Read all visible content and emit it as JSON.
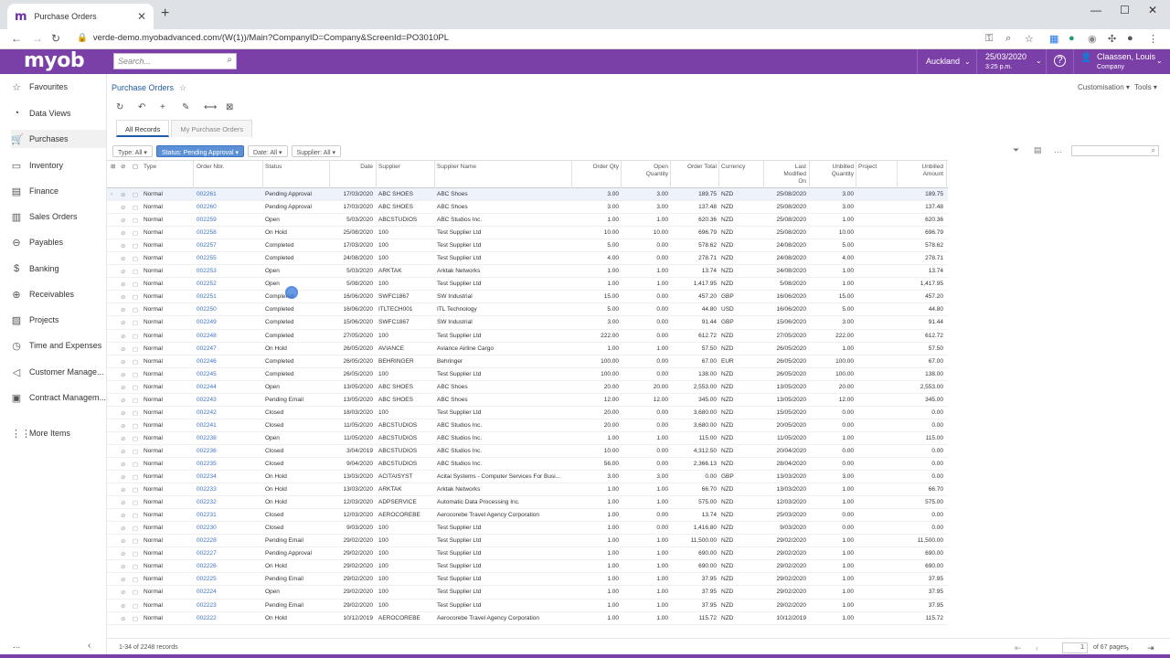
{
  "browser": {
    "tab_title": "Purchase Orders",
    "url": "verde-demo.myobadvanced.com/(W(1))/Main?CompanyID=Company&ScreenId=PO3010PL"
  },
  "topbar": {
    "logo": "myob",
    "search_placeholder": "Search...",
    "branch": "Auckland",
    "date": "25/03/2020",
    "time": "3:25 p.m.",
    "user_name": "Claassen, Louis",
    "user_company": "Company",
    "accent": "#7b3fa8"
  },
  "sidebar": {
    "items": [
      {
        "label": "Favourites",
        "icon": "star-icon"
      },
      {
        "label": "Data Views",
        "icon": "chart-icon"
      },
      {
        "label": "Purchases",
        "icon": "cart-icon"
      },
      {
        "label": "Inventory",
        "icon": "truck-icon"
      },
      {
        "label": "Finance",
        "icon": "document-icon"
      },
      {
        "label": "Sales Orders",
        "icon": "receipt-icon"
      },
      {
        "label": "Payables",
        "icon": "minus-circle-icon"
      },
      {
        "label": "Banking",
        "icon": "dollar-icon"
      },
      {
        "label": "Receivables",
        "icon": "plus-circle-icon"
      },
      {
        "label": "Projects",
        "icon": "projects-icon"
      },
      {
        "label": "Time and Expenses",
        "icon": "clock-icon"
      },
      {
        "label": "Customer Manage...",
        "icon": "megaphone-icon"
      },
      {
        "label": "Contract Managem...",
        "icon": "contract-icon"
      },
      {
        "label": "More Items",
        "icon": "grid-icon"
      }
    ],
    "footer_more": "...",
    "collapse": "‹"
  },
  "page": {
    "breadcrumb": "Purchase Orders",
    "customisation": "Customisation",
    "tools": "Tools",
    "tabs": [
      "All Records",
      "My Purchase Orders"
    ],
    "filters": [
      "Type: All",
      "Status: Pending Approval",
      "Date: All",
      "Supplier: All"
    ]
  },
  "grid": {
    "headers": {
      "type": "Type",
      "order_nbr": "Order Nbr.",
      "status": "Status",
      "date": "Date",
      "supplier": "Supplier",
      "supplier_name": "Supplier Name",
      "order_qty": "Order Qty",
      "open_qty_1": "Open",
      "open_qty_2": "Quantity",
      "order_total": "Order Total",
      "currency": "Currency",
      "last_mod_1": "Last",
      "last_mod_2": "Modified",
      "last_mod_3": "On",
      "unbilled_qty_1": "Unbilled",
      "unbilled_qty_2": "Quantity",
      "project": "Project",
      "unbilled_amt_1": "Unbilled",
      "unbilled_amt_2": "Amount"
    },
    "rows": [
      [
        "Normal",
        "002261",
        "Pending Approval",
        "17/03/2020",
        "ABC SHOES",
        "ABC Shoes",
        "3.00",
        "3.00",
        "189.75",
        "NZD",
        "25/08/2020",
        "3.00",
        "189.75"
      ],
      [
        "Normal",
        "002260",
        "Pending Approval",
        "17/03/2020",
        "ABC SHOES",
        "ABC Shoes",
        "3.00",
        "3.00",
        "137.48",
        "NZD",
        "25/08/2020",
        "3.00",
        "137.48"
      ],
      [
        "Normal",
        "002259",
        "Open",
        "5/03/2020",
        "ABCSTUDIOS",
        "ABC Studios Inc.",
        "1.00",
        "1.00",
        "620.36",
        "NZD",
        "25/08/2020",
        "1.00",
        "620.36"
      ],
      [
        "Normal",
        "002258",
        "On Hold",
        "25/08/2020",
        "100",
        "Test Supplier Ltd",
        "10.00",
        "10.00",
        "696.79",
        "NZD",
        "25/08/2020",
        "10.00",
        "696.79"
      ],
      [
        "Normal",
        "002257",
        "Completed",
        "17/03/2020",
        "100",
        "Test Supplier Ltd",
        "5.00",
        "0.00",
        "578.62",
        "NZD",
        "24/08/2020",
        "5.00",
        "578.62"
      ],
      [
        "Normal",
        "002255",
        "Completed",
        "24/08/2020",
        "100",
        "Test Supplier Ltd",
        "4.00",
        "0.00",
        "278.71",
        "NZD",
        "24/08/2020",
        "4.00",
        "278.71"
      ],
      [
        "Normal",
        "002253",
        "Open",
        "5/03/2020",
        "ARKTAK",
        "Arktak Networks",
        "1.00",
        "1.00",
        "13.74",
        "NZD",
        "24/08/2020",
        "1.00",
        "13.74"
      ],
      [
        "Normal",
        "002252",
        "Open",
        "5/08/2020",
        "100",
        "Test Supplier Ltd",
        "1.00",
        "1.00",
        "1,417.95",
        "NZD",
        "5/08/2020",
        "1.00",
        "1,417.95"
      ],
      [
        "Normal",
        "002251",
        "Completed",
        "16/06/2020",
        "SWFC1867",
        "SW Industrial",
        "15.00",
        "0.00",
        "457.20",
        "GBP",
        "16/06/2020",
        "15.00",
        "457.20"
      ],
      [
        "Normal",
        "002250",
        "Completed",
        "16/06/2020",
        "ITLTECH001",
        "ITL Technology",
        "5.00",
        "0.00",
        "44.80",
        "USD",
        "16/06/2020",
        "5.00",
        "44.80"
      ],
      [
        "Normal",
        "002249",
        "Completed",
        "15/06/2020",
        "SWFC1867",
        "SW Industrial",
        "3.00",
        "0.00",
        "91.44",
        "GBP",
        "15/06/2020",
        "3.00",
        "91.44"
      ],
      [
        "Normal",
        "002248",
        "Completed",
        "27/05/2020",
        "100",
        "Test Supplier Ltd",
        "222.00",
        "0.00",
        "612.72",
        "NZD",
        "27/05/2020",
        "222.00",
        "612.72"
      ],
      [
        "Normal",
        "002247",
        "On Hold",
        "26/05/2020",
        "AVIANCE",
        "Aviance Airline Cargo",
        "1.00",
        "1.00",
        "57.50",
        "NZD",
        "26/05/2020",
        "1.00",
        "57.50"
      ],
      [
        "Normal",
        "002246",
        "Completed",
        "26/05/2020",
        "BEHRINGER",
        "Behringer",
        "100.00",
        "0.00",
        "67.00",
        "EUR",
        "26/05/2020",
        "100.00",
        "67.00"
      ],
      [
        "Normal",
        "002245",
        "Completed",
        "26/05/2020",
        "100",
        "Test Supplier Ltd",
        "100.00",
        "0.00",
        "138.00",
        "NZD",
        "26/05/2020",
        "100.00",
        "138.00"
      ],
      [
        "Normal",
        "002244",
        "Open",
        "13/05/2020",
        "ABC SHOES",
        "ABC Shoes",
        "20.00",
        "20.00",
        "2,553.00",
        "NZD",
        "13/05/2020",
        "20.00",
        "2,553.00"
      ],
      [
        "Normal",
        "002243",
        "Pending Email",
        "13/05/2020",
        "ABC SHOES",
        "ABC Shoes",
        "12.00",
        "12.00",
        "345.00",
        "NZD",
        "13/05/2020",
        "12.00",
        "345.00"
      ],
      [
        "Normal",
        "002242",
        "Closed",
        "18/03/2020",
        "100",
        "Test Supplier Ltd",
        "20.00",
        "0.00",
        "3,680.00",
        "NZD",
        "15/05/2020",
        "0.00",
        "0.00"
      ],
      [
        "Normal",
        "002241",
        "Closed",
        "11/05/2020",
        "ABCSTUDIOS",
        "ABC Studios Inc.",
        "20.00",
        "0.00",
        "3,680.00",
        "NZD",
        "20/05/2020",
        "0.00",
        "0.00"
      ],
      [
        "Normal",
        "002238",
        "Open",
        "11/05/2020",
        "ABCSTUDIOS",
        "ABC Studios Inc.",
        "1.00",
        "1.00",
        "115.00",
        "NZD",
        "11/05/2020",
        "1.00",
        "115.00"
      ],
      [
        "Normal",
        "002236",
        "Closed",
        "3/04/2019",
        "ABCSTUDIOS",
        "ABC Studios Inc.",
        "10.00",
        "0.00",
        "4,312.50",
        "NZD",
        "20/04/2020",
        "0.00",
        "0.00"
      ],
      [
        "Normal",
        "002235",
        "Closed",
        "9/04/2020",
        "ABCSTUDIOS",
        "ABC Studios Inc.",
        "56.00",
        "0.00",
        "2,366.13",
        "NZD",
        "28/04/2020",
        "0.00",
        "0.00"
      ],
      [
        "Normal",
        "002234",
        "On Hold",
        "13/03/2020",
        "ACITAISYST",
        "Acitai Systems - Computer Services For Busi...",
        "3.00",
        "3.00",
        "0.00",
        "GBP",
        "13/03/2020",
        "3.00",
        "0.00"
      ],
      [
        "Normal",
        "002233",
        "On Hold",
        "13/03/2020",
        "ARKTAK",
        "Arktak Networks",
        "1.00",
        "1.00",
        "66.70",
        "NZD",
        "13/03/2020",
        "1.00",
        "66.70"
      ],
      [
        "Normal",
        "002232",
        "On Hold",
        "12/03/2020",
        "ADPSERVICE",
        "Automatic Data Processing Inc.",
        "1.00",
        "1.00",
        "575.00",
        "NZD",
        "12/03/2020",
        "1.00",
        "575.00"
      ],
      [
        "Normal",
        "002231",
        "Closed",
        "12/03/2020",
        "AEROCOREBE",
        "Aerocorebe Travel Agency Corporation",
        "1.00",
        "0.00",
        "13.74",
        "NZD",
        "25/03/2020",
        "0.00",
        "0.00"
      ],
      [
        "Normal",
        "002230",
        "Closed",
        "9/03/2020",
        "100",
        "Test Supplier Ltd",
        "1.00",
        "0.00",
        "1,416.80",
        "NZD",
        "9/03/2020",
        "0.00",
        "0.00"
      ],
      [
        "Normal",
        "002228",
        "Pending Email",
        "29/02/2020",
        "100",
        "Test Supplier Ltd",
        "1.00",
        "1.00",
        "11,500.00",
        "NZD",
        "29/02/2020",
        "1.00",
        "11,500.00"
      ],
      [
        "Normal",
        "002227",
        "Pending Approval",
        "29/02/2020",
        "100",
        "Test Supplier Ltd",
        "1.00",
        "1.00",
        "690.00",
        "NZD",
        "29/02/2020",
        "1.00",
        "690.00"
      ],
      [
        "Normal",
        "002226",
        "On Hold",
        "29/02/2020",
        "100",
        "Test Supplier Ltd",
        "1.00",
        "1.00",
        "690.00",
        "NZD",
        "29/02/2020",
        "1.00",
        "690.00"
      ],
      [
        "Normal",
        "002225",
        "Pending Email",
        "29/02/2020",
        "100",
        "Test Supplier Ltd",
        "1.00",
        "1.00",
        "37.95",
        "NZD",
        "29/02/2020",
        "1.00",
        "37.95"
      ],
      [
        "Normal",
        "002224",
        "Open",
        "29/02/2020",
        "100",
        "Test Supplier Ltd",
        "1.00",
        "1.00",
        "37.95",
        "NZD",
        "29/02/2020",
        "1.00",
        "37.95"
      ],
      [
        "Normal",
        "002223",
        "Pending Email",
        "29/02/2020",
        "100",
        "Test Supplier Ltd",
        "1.00",
        "1.00",
        "37.95",
        "NZD",
        "29/02/2020",
        "1.00",
        "37.95"
      ],
      [
        "Normal",
        "002222",
        "On Hold",
        "10/12/2019",
        "AEROCOREBE",
        "Aerocorebe Travel Agency Corporation",
        "1.00",
        "1.00",
        "115.72",
        "NZD",
        "10/12/2019",
        "1.00",
        "115.72"
      ]
    ]
  },
  "pager": {
    "records": "1-34 of 2248 records",
    "page": "1",
    "of_pages": "of 67 pages"
  }
}
